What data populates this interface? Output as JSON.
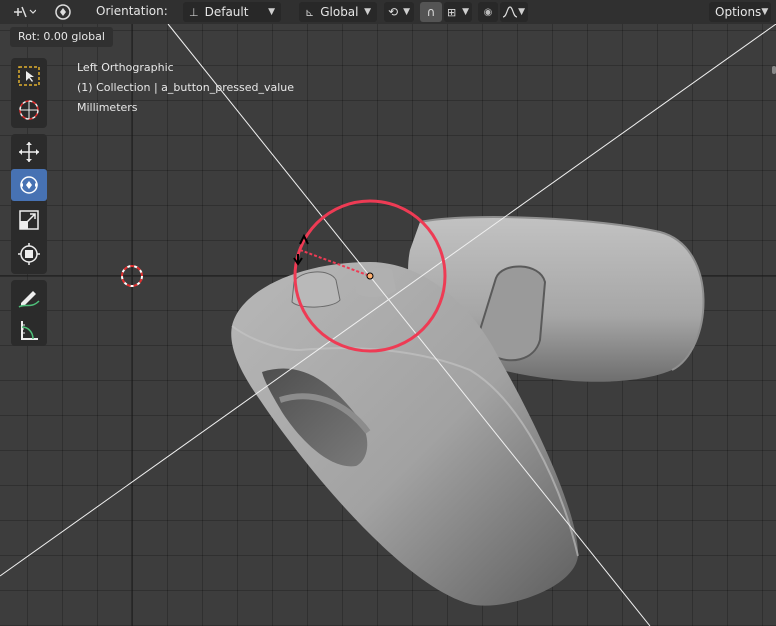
{
  "header": {
    "orientation_label": "Orientation:",
    "orientation_value": "Default",
    "transform_space": "Global",
    "options_label": "Options"
  },
  "status": {
    "rotation_text": "Rot: 0.00 global"
  },
  "viewport_info": {
    "view_name": "Left Orthographic",
    "collection": "(1) Collection | a_button_pressed_value",
    "units": "Millimeters"
  },
  "tools": [
    {
      "name": "select-box",
      "icon": "select-box-icon",
      "active": false
    },
    {
      "name": "cursor",
      "icon": "cursor-icon",
      "active": false
    },
    {
      "name": "move",
      "icon": "move-icon",
      "active": false
    },
    {
      "name": "rotate",
      "icon": "rotate-icon",
      "active": true
    },
    {
      "name": "scale",
      "icon": "scale-icon",
      "active": false
    },
    {
      "name": "transform",
      "icon": "transform-icon",
      "active": false
    },
    {
      "name": "annotate",
      "icon": "annotate-icon",
      "active": false
    },
    {
      "name": "measure",
      "icon": "measure-icon",
      "active": false
    }
  ],
  "colors": {
    "header_bg": "#303030",
    "viewport_bg": "#3d3d3d",
    "active_tool": "#4772b3",
    "rotate_gizmo": "#ee3b54",
    "object": "#a8a8a8"
  }
}
